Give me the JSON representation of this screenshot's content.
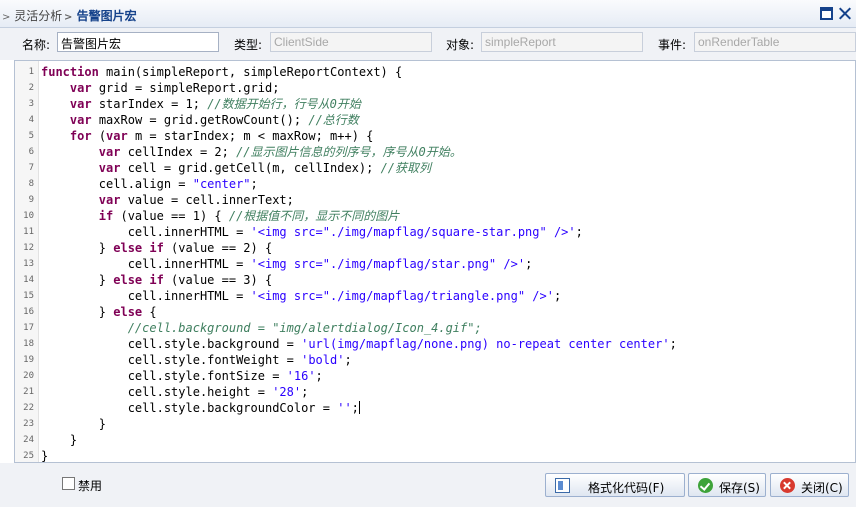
{
  "titlebar": {
    "breadcrumb_parent": "灵活分析",
    "breadcrumb_current": "告警图片宏"
  },
  "form": {
    "name_label": "名称:",
    "name_value": "告警图片宏",
    "type_label": "类型:",
    "type_value": "ClientSide",
    "object_label": "对象:",
    "object_value": "simpleReport",
    "event_label": "事件:",
    "event_value": "onRenderTable"
  },
  "code_lines": [
    [
      [
        "kw",
        "function"
      ],
      [
        "t",
        " main(simpleReport, simpleReportContext) {"
      ]
    ],
    [
      [
        "t",
        "    "
      ],
      [
        "kw",
        "var"
      ],
      [
        "t",
        " grid = simpleReport.grid;"
      ]
    ],
    [
      [
        "t",
        "    "
      ],
      [
        "kw",
        "var"
      ],
      [
        "t",
        " starIndex = 1; "
      ],
      [
        "cmt",
        "//数据开始行，行号从0开始"
      ]
    ],
    [
      [
        "t",
        "    "
      ],
      [
        "kw",
        "var"
      ],
      [
        "t",
        " maxRow = grid.getRowCount(); "
      ],
      [
        "cmt",
        "//总行数"
      ]
    ],
    [
      [
        "t",
        "    "
      ],
      [
        "kw",
        "for"
      ],
      [
        "t",
        " ("
      ],
      [
        "kw",
        "var"
      ],
      [
        "t",
        " m = starIndex; m < maxRow; m++) {"
      ]
    ],
    [
      [
        "t",
        "        "
      ],
      [
        "kw",
        "var"
      ],
      [
        "t",
        " cellIndex = 2; "
      ],
      [
        "cmt",
        "//显示图片信息的列序号，序号从0开始。"
      ]
    ],
    [
      [
        "t",
        "        "
      ],
      [
        "kw",
        "var"
      ],
      [
        "t",
        " cell = grid.getCell(m, cellIndex); "
      ],
      [
        "cmt",
        "//获取列"
      ]
    ],
    [
      [
        "t",
        "        cell.align = "
      ],
      [
        "str",
        "\"center\""
      ],
      [
        "t",
        ";"
      ]
    ],
    [
      [
        "t",
        "        "
      ],
      [
        "kw",
        "var"
      ],
      [
        "t",
        " value = cell.innerText;"
      ]
    ],
    [
      [
        "t",
        "        "
      ],
      [
        "kw",
        "if"
      ],
      [
        "t",
        " (value == 1) { "
      ],
      [
        "cmt",
        "//根据值不同，显示不同的图片"
      ]
    ],
    [
      [
        "t",
        "            cell.innerHTML = "
      ],
      [
        "str",
        "'<img src=\"./img/mapflag/square-star.png\" />'"
      ],
      [
        "t",
        ";"
      ]
    ],
    [
      [
        "t",
        "        } "
      ],
      [
        "kw",
        "else if"
      ],
      [
        "t",
        " (value == 2) {"
      ]
    ],
    [
      [
        "t",
        "            cell.innerHTML = "
      ],
      [
        "str",
        "'<img src=\"./img/mapflag/star.png\" />'"
      ],
      [
        "t",
        ";"
      ]
    ],
    [
      [
        "t",
        "        } "
      ],
      [
        "kw",
        "else if"
      ],
      [
        "t",
        " (value == 3) {"
      ]
    ],
    [
      [
        "t",
        "            cell.innerHTML = "
      ],
      [
        "str",
        "'<img src=\"./img/mapflag/triangle.png\" />'"
      ],
      [
        "t",
        ";"
      ]
    ],
    [
      [
        "t",
        "        } "
      ],
      [
        "kw",
        "else"
      ],
      [
        "t",
        " {"
      ]
    ],
    [
      [
        "t",
        "            "
      ],
      [
        "cmt",
        "//cell.background = \"img/alertdialog/Icon_4.gif\";"
      ]
    ],
    [
      [
        "t",
        "            cell.style.background = "
      ],
      [
        "str",
        "'url(img/mapflag/none.png) no-repeat center center'"
      ],
      [
        "t",
        ";"
      ]
    ],
    [
      [
        "t",
        "            cell.style.fontWeight = "
      ],
      [
        "str",
        "'bold'"
      ],
      [
        "t",
        ";"
      ]
    ],
    [
      [
        "t",
        "            cell.style.fontSize = "
      ],
      [
        "str",
        "'16'"
      ],
      [
        "t",
        ";"
      ]
    ],
    [
      [
        "t",
        "            cell.style.height = "
      ],
      [
        "str",
        "'28'"
      ],
      [
        "t",
        ";"
      ]
    ],
    [
      [
        "t",
        "            cell.style.backgroundColor = "
      ],
      [
        "str",
        "''"
      ],
      [
        "t",
        ";"
      ]
    ],
    [
      [
        "t",
        "        }"
      ]
    ],
    [
      [
        "t",
        "    }"
      ]
    ],
    [
      [
        "t",
        "}"
      ]
    ]
  ],
  "cursor_line": 22,
  "bottombar": {
    "disable_label": "禁用",
    "format_label": "格式化代码(F)",
    "save_label": "保存(S)",
    "close_label": "关闭(C)"
  },
  "colors": {
    "keyword": "#7f0055",
    "string": "#2a00ff",
    "comment": "#3f7f5f",
    "title_accent": "#15428b"
  }
}
